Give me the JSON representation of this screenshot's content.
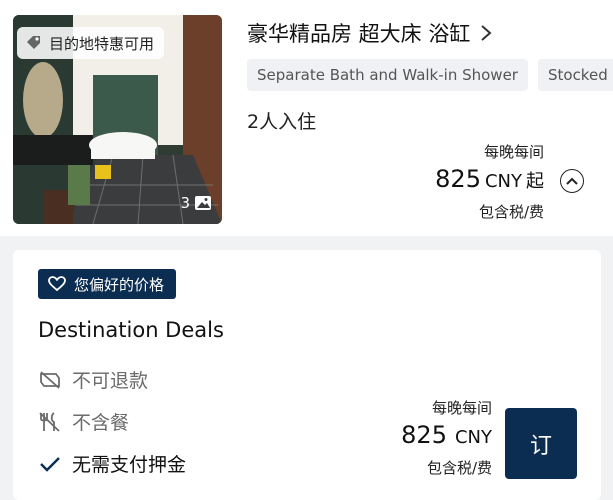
{
  "room": {
    "photo_badge": "目的地特惠可用",
    "photo_count": "3",
    "title": "豪华精品房 超大床 浴缸",
    "chips": [
      "Separate Bath and Walk-in Shower",
      "Stocked"
    ],
    "occupancy": "2人入住",
    "per_night": "每晚每间",
    "price_amount": "825",
    "price_currency": "CNY",
    "price_suffix": "起",
    "tax_note": "包含税/费"
  },
  "deal": {
    "badge": "您偏好的价格",
    "title": "Destination Deals",
    "policies": [
      {
        "label": "不可退款",
        "icon": "no-refund-icon",
        "status": "unavailable"
      },
      {
        "label": "不含餐",
        "icon": "no-meal-icon",
        "status": "unavailable"
      },
      {
        "label": "无需支付押金",
        "icon": "check-icon",
        "status": "included"
      }
    ],
    "per_night": "每晚每间",
    "price_amount": "825",
    "price_currency": "CNY",
    "tax_note": "包含税/费",
    "book_label": "订"
  },
  "colors": {
    "brand_navy": "#0c2d52",
    "chip_bg": "#eff1f4",
    "page_bg": "#f1f2f4"
  }
}
